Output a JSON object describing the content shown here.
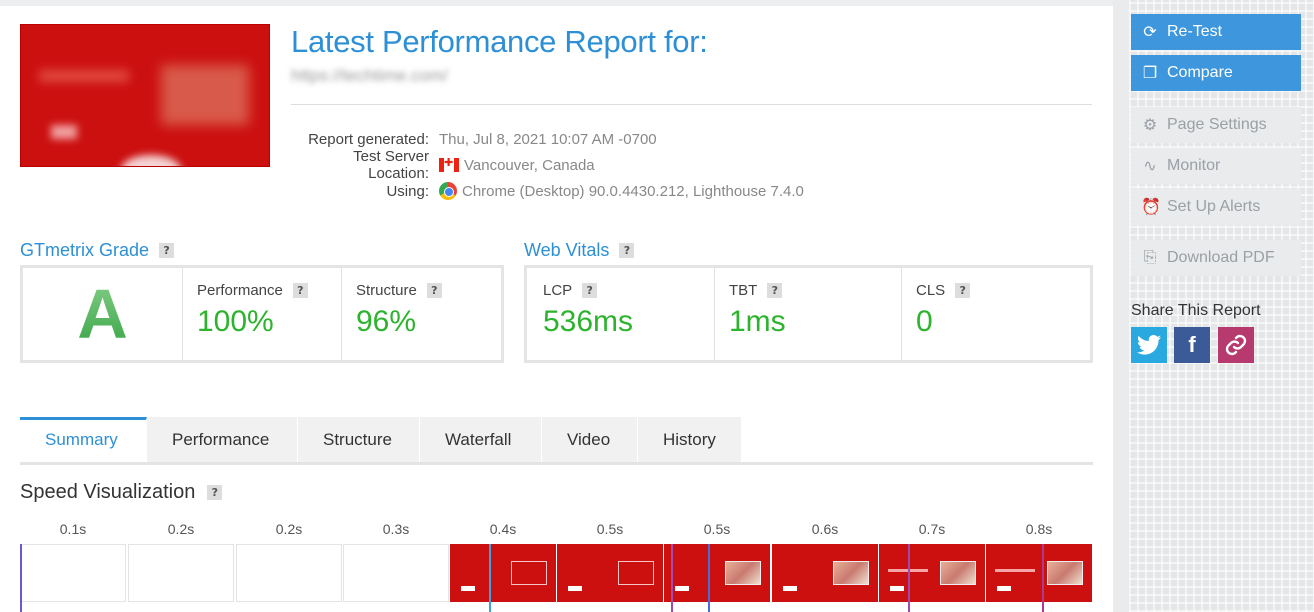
{
  "header": {
    "title": "Latest Performance Report for:",
    "url": "https://techtime.com/",
    "report_generated_label": "Report generated:",
    "report_generated_value": "Thu, Jul 8, 2021 10:07 AM -0700",
    "server_label": "Test Server Location:",
    "server_value": "Vancouver, Canada",
    "using_label": "Using:",
    "using_value": "Chrome (Desktop) 90.0.4430.212, Lighthouse 7.4.0"
  },
  "grade": {
    "heading": "GTmetrix Grade",
    "letter": "A",
    "performance_label": "Performance",
    "performance_value": "100%",
    "structure_label": "Structure",
    "structure_value": "96%"
  },
  "vitals": {
    "heading": "Web Vitals",
    "lcp_label": "LCP",
    "lcp_value": "536ms",
    "tbt_label": "TBT",
    "tbt_value": "1ms",
    "cls_label": "CLS",
    "cls_value": "0"
  },
  "tabs": [
    {
      "label": "Summary"
    },
    {
      "label": "Performance"
    },
    {
      "label": "Structure"
    },
    {
      "label": "Waterfall"
    },
    {
      "label": "Video"
    },
    {
      "label": "History"
    }
  ],
  "speed": {
    "heading": "Speed Visualization",
    "frames": [
      "0.1s",
      "0.2s",
      "0.2s",
      "0.3s",
      "0.4s",
      "0.5s",
      "0.5s",
      "0.6s",
      "0.7s",
      "0.8s"
    ]
  },
  "sidebar": {
    "retest": "Re-Test",
    "compare": "Compare",
    "page_settings": "Page Settings",
    "monitor": "Monitor",
    "alerts": "Set Up Alerts",
    "pdf": "Download PDF",
    "share_heading": "Share This Report"
  },
  "colors": {
    "accent": "#2d8fd5",
    "good": "#2db32d",
    "button_blue": "#3e97dc"
  },
  "icons": {
    "retest": "refresh-icon",
    "compare": "copy-icon",
    "page_settings": "gear-icon",
    "monitor": "pulse-icon",
    "alerts": "alarm-icon",
    "pdf": "pdf-icon",
    "twitter": "twitter-icon",
    "facebook": "facebook-icon",
    "link": "link-icon"
  }
}
